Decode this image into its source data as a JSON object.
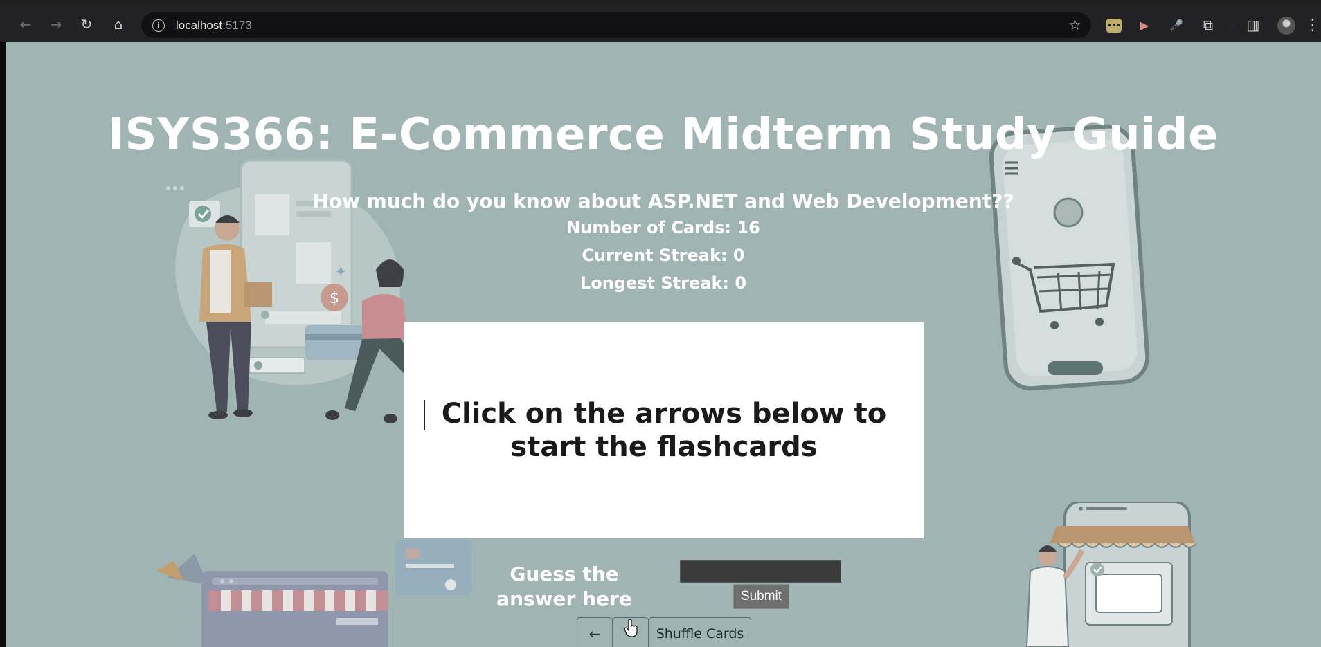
{
  "browser": {
    "back_icon": "←",
    "forward_icon": "→",
    "reload_icon": "↻",
    "home_icon": "⌂",
    "info_icon": "i",
    "url_host": "localhost",
    "url_port": ":5173",
    "bookmark_icon": "☆",
    "ext1_label": "•••",
    "ext2_icon": "▶",
    "ext3_icon": "🎤",
    "extensions_icon": "⧉",
    "sidepanel_icon": "▥",
    "menu_icon": "⋮"
  },
  "page": {
    "title": "ISYS366: E-Commerce Midterm Study Guide",
    "subtitle": "How much do you know about ASP.NET and Web Development??",
    "stats": {
      "cards": "Number of Cards: 16",
      "current_streak": "Current Streak: 0",
      "longest_streak": "Longest Streak: 0"
    },
    "card_text": "Click on the arrows below to start the flashcards",
    "guess_label": "Guess the answer here",
    "guess_value": "",
    "submit_label": "Submit",
    "prev_label": "←",
    "next_label": "→",
    "shuffle_label": "Shuffle Cards"
  },
  "colors": {
    "page_bg": "#a0b5b3",
    "card_bg": "#ffffff",
    "chrome_bg": "#222224"
  }
}
